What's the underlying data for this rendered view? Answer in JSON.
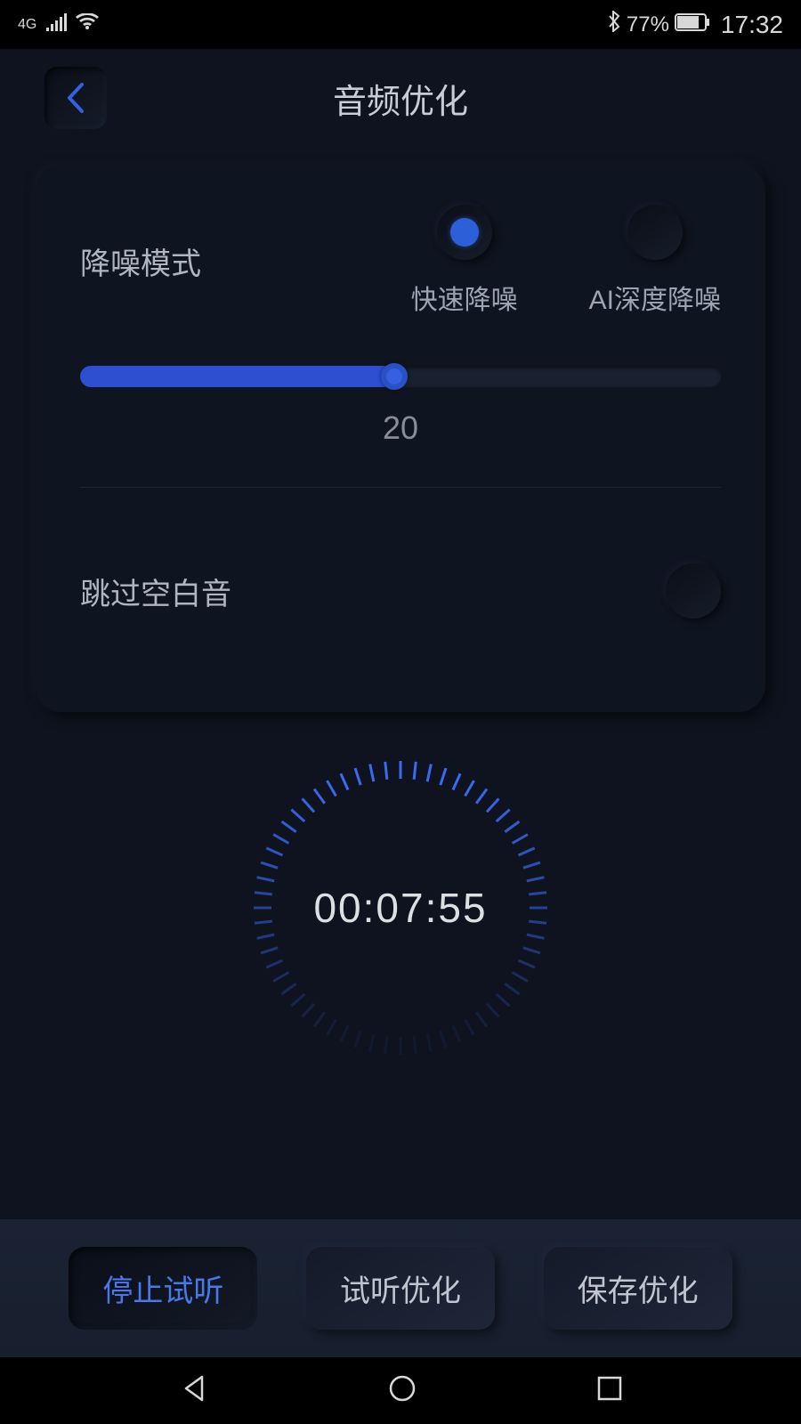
{
  "statusBar": {
    "network": "4G",
    "batteryPercent": "77%",
    "time": "17:32"
  },
  "header": {
    "title": "音频优化"
  },
  "noiseReduction": {
    "label": "降噪模式",
    "options": {
      "fast": "快速降噪",
      "aiDeep": "AI深度降噪"
    },
    "sliderValue": "20"
  },
  "skipBlank": {
    "label": "跳过空白音"
  },
  "timer": {
    "display": "00:07:55"
  },
  "buttons": {
    "stopPreview": "停止试听",
    "previewOptimize": "试听优化",
    "saveOptimize": "保存优化"
  }
}
